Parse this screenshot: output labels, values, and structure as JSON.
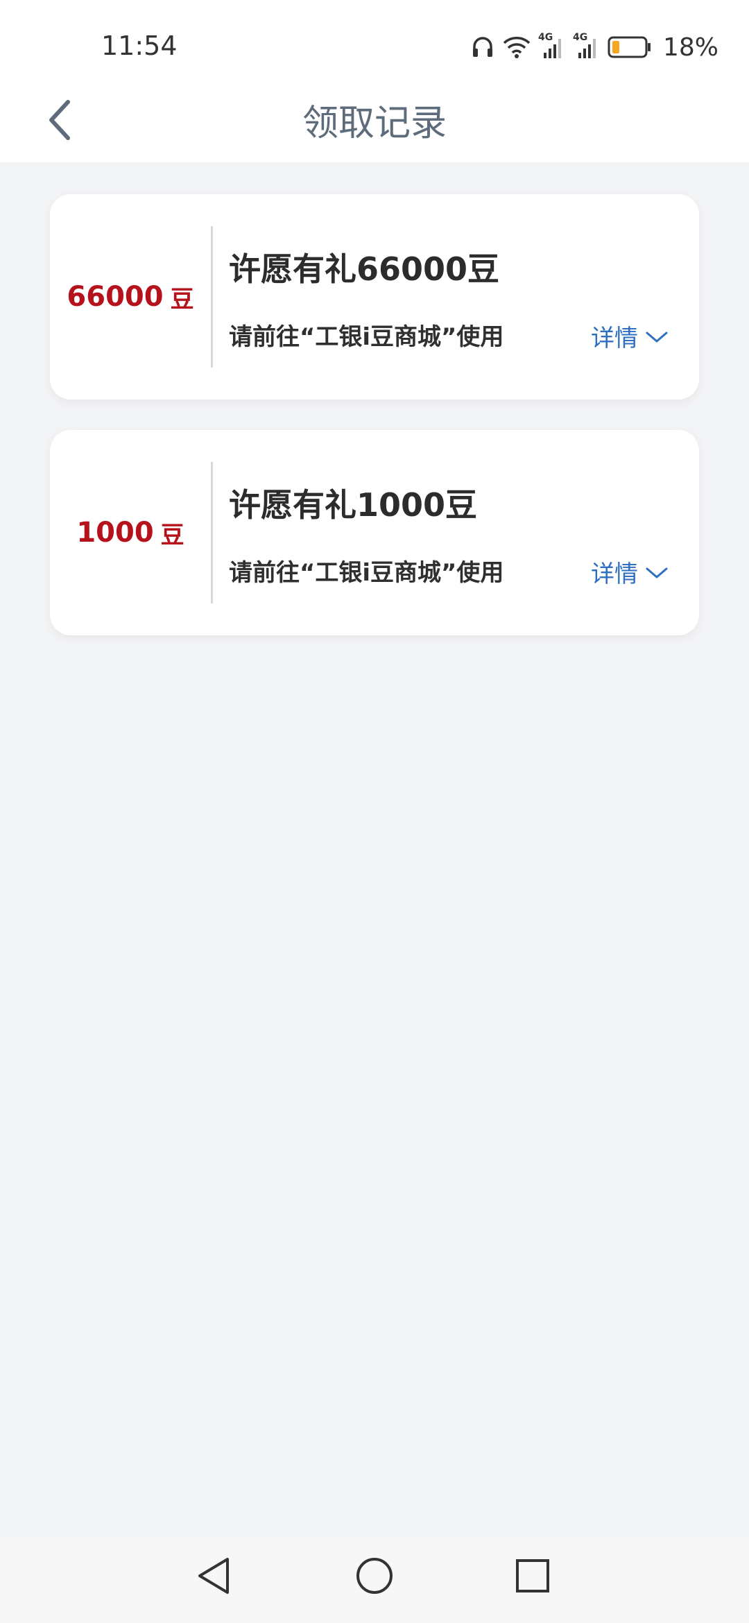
{
  "status_bar": {
    "time": "11:54",
    "battery_percent": "18%",
    "battery_level": 0.18,
    "network_labels": [
      "4G",
      "4G"
    ],
    "icons": [
      "headphones-icon",
      "wifi-icon",
      "signal-icon",
      "battery-icon"
    ]
  },
  "nav": {
    "title": "领取记录",
    "back_icon": "chevron-left-icon"
  },
  "records": [
    {
      "amount": "66000",
      "unit": "豆",
      "title": "许愿有礼66000豆",
      "desc": "请前往“工银i豆商城”使用",
      "detail_label": "详情"
    },
    {
      "amount": "1000",
      "unit": "豆",
      "title": "许愿有礼1000豆",
      "desc": "请前往“工银i豆商城”使用",
      "detail_label": "详情"
    }
  ],
  "colors": {
    "amount": "#b5121b",
    "link": "#2f6fc0",
    "title": "#5d6b7a",
    "background": "#f3f4f6",
    "battery_fill": "#f5a623"
  },
  "system_nav": [
    "back-triangle-icon",
    "home-circle-icon",
    "recents-square-icon"
  ]
}
